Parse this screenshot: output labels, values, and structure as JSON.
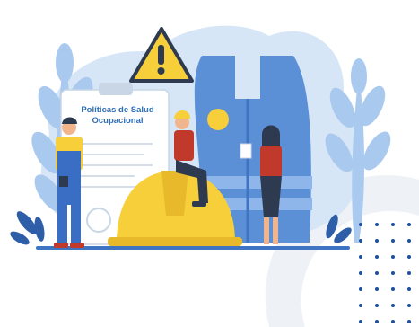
{
  "clipboard": {
    "title_line1": "Políticas de Salud",
    "title_line2": "Ocupacional"
  },
  "colors": {
    "background_blob": "#d6e6f6",
    "leaf": "#a9c9ee",
    "leaf_dark": "#2f5ea8",
    "vest": "#5b8fd6",
    "vest_dark": "#3f74c2",
    "helmet": "#f6cf3a",
    "warning_sign": "#f6cf3a",
    "title_text": "#2f6fb8",
    "dots": "#1f4f9a",
    "ring": "#eef2f7"
  },
  "icons": [
    "warning-sign-icon",
    "hard-hat-icon",
    "safety-vest-icon",
    "clipboard-icon"
  ]
}
